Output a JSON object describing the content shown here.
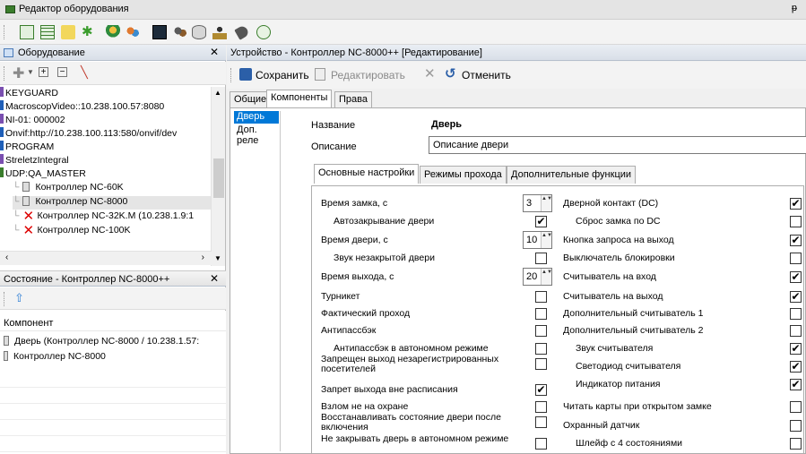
{
  "window": {
    "title": "Редактор оборудования",
    "pin_glyph": "ᵽ"
  },
  "toolbar": {
    "icons": [
      "grid-view-icon",
      "table-icon",
      "notes-icon",
      "run-icon",
      "user-icon",
      "group-icon",
      "monitor-icon",
      "users-icon",
      "drive-icon",
      "person-icon",
      "tag-icon",
      "refresh-icon"
    ]
  },
  "equipment_pane": {
    "title": "Оборудование",
    "tree": [
      {
        "label": "KEYGUARD",
        "mark": "#7a4fb0"
      },
      {
        "label": "MacroscopVideo::10.238.100.57:8080",
        "mark": "#1f5fb8"
      },
      {
        "label": "NI-01: 000002",
        "mark": "#7a4fb0"
      },
      {
        "label": "Onvif:http://10.238.100.113:580/onvif/dev",
        "mark": "#1f5fb8"
      },
      {
        "label": "PROGRAM",
        "mark": "#1f5fb8"
      },
      {
        "label": "StreletzIntegral",
        "mark": "#7a4fb0"
      },
      {
        "label": "UDP:QA_MASTER",
        "mark": "#3a7d2c"
      },
      {
        "label": "Контроллер NC-60K",
        "type": "device"
      },
      {
        "label": "Контроллер NC-8000",
        "type": "device",
        "selected": true
      },
      {
        "label": "Контроллер NC-32K.M (10.238.1.9:1",
        "type": "error"
      },
      {
        "label": "Контроллер NC-100K",
        "type": "error"
      }
    ]
  },
  "status_pane": {
    "title": "Состояние - Контроллер NC-8000++",
    "column_header": "Компонент",
    "rows": [
      "Дверь (Контроллер NC-8000 / 10.238.1.57:",
      "Контроллер NC-8000"
    ]
  },
  "device_pane": {
    "title": "Устройство - Контроллер NC-8000++ [Редактирование]",
    "actions": {
      "save": "Сохранить",
      "edit": "Редактировать",
      "cancel": "Отменить"
    },
    "tabs": [
      "Общие",
      "Компоненты",
      "Права"
    ],
    "active_tab": "Компоненты",
    "components": [
      "Дверь",
      "Доп. реле"
    ],
    "selected_component": "Дверь",
    "name_label": "Название",
    "name_value": "Дверь",
    "desc_label": "Описание",
    "desc_value": "Описание двери",
    "inner_tabs": [
      "Основные настройки",
      "Режимы прохода",
      "Дополнительные функции"
    ],
    "inner_active": "Основные настройки",
    "left_options": [
      {
        "label": "Время замка, с",
        "spin": "3"
      },
      {
        "label": "Автозакрывание двери",
        "checked": true,
        "indent": true
      },
      {
        "label": "Время двери, с",
        "spin": "10"
      },
      {
        "label": "Звук незакрытой двери",
        "checked": false,
        "indent": true
      },
      {
        "label": "Время выхода, с",
        "spin": "20"
      },
      {
        "label": "Турникет",
        "checked": false
      },
      {
        "label": "Фактический проход",
        "checked": false
      },
      {
        "label": "Антипассбэк",
        "checked": false
      },
      {
        "label": "Антипассбэк в автономном режиме",
        "checked": false,
        "indent": true
      },
      {
        "label": "Запрещен выход незарегистрированных посетителей",
        "checked": false
      },
      {
        "label": "Запрет выхода вне расписания",
        "checked": true
      },
      {
        "label": "Взлом не на охране",
        "checked": false
      },
      {
        "label": "Восстанавливать состояние двери после включения",
        "checked": false
      },
      {
        "label": "Не закрывать дверь в автономном режиме",
        "checked": false
      }
    ],
    "right_options": [
      {
        "label": "Дверной контакт (DC)",
        "checked": true
      },
      {
        "label": "Сброс замка по DC",
        "checked": false,
        "indent": true
      },
      {
        "label": "Кнопка запроса на выход",
        "checked": true
      },
      {
        "label": "Выключатель блокировки",
        "checked": false
      },
      {
        "label": "Считыватель на вход",
        "checked": true
      },
      {
        "label": "Считыватель на выход",
        "checked": true
      },
      {
        "label": "Дополнительный считыватель 1",
        "checked": false
      },
      {
        "label": "Дополнительный считыватель 2",
        "checked": false
      },
      {
        "label": "Звук считывателя",
        "checked": true,
        "indent": true
      },
      {
        "label": "Светодиод считывателя",
        "checked": true,
        "indent": true
      },
      {
        "label": "Индикатор питания",
        "checked": true,
        "indent": true
      },
      {
        "label": "Читать карты при открытом замке",
        "checked": false
      },
      {
        "label": "Охранный датчик",
        "checked": false
      },
      {
        "label": "Шлейф с 4 состояниями",
        "checked": false,
        "indent": true
      }
    ]
  },
  "colors": {
    "accent": "#0078d7",
    "header_bg": "#dfe5ee",
    "error": "#dd0000",
    "check": "#000000"
  }
}
